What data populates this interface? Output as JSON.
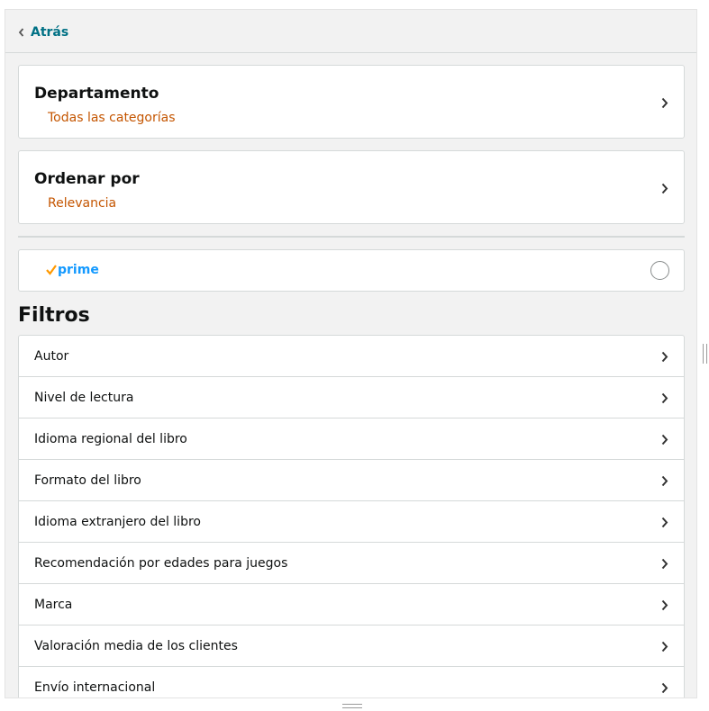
{
  "header": {
    "back_label": "Atrás"
  },
  "department": {
    "title": "Departamento",
    "value": "Todas las categorías"
  },
  "sort": {
    "title": "Ordenar por",
    "value": "Relevancia"
  },
  "prime": {
    "label": "prime",
    "selected": false
  },
  "filters": {
    "title": "Filtros",
    "items": [
      {
        "label": "Autor"
      },
      {
        "label": "Nivel de lectura"
      },
      {
        "label": "Idioma regional del libro"
      },
      {
        "label": "Formato del libro"
      },
      {
        "label": "Idioma extranjero del libro"
      },
      {
        "label": "Recomendación por edades para juegos"
      },
      {
        "label": "Marca"
      },
      {
        "label": "Valoración media de los clientes"
      },
      {
        "label": "Envío internacional"
      }
    ]
  },
  "colors": {
    "link": "#007185",
    "selected_value": "#c45500",
    "prime_blue": "#1399ff",
    "prime_check": "#ff9900",
    "panel_bg": "#f2f2f2",
    "border": "#d5d9d9"
  },
  "icons": {
    "back": "chevron-left-icon",
    "row": "chevron-right-icon",
    "prime": "prime-check-icon",
    "radio": "radio-button"
  }
}
